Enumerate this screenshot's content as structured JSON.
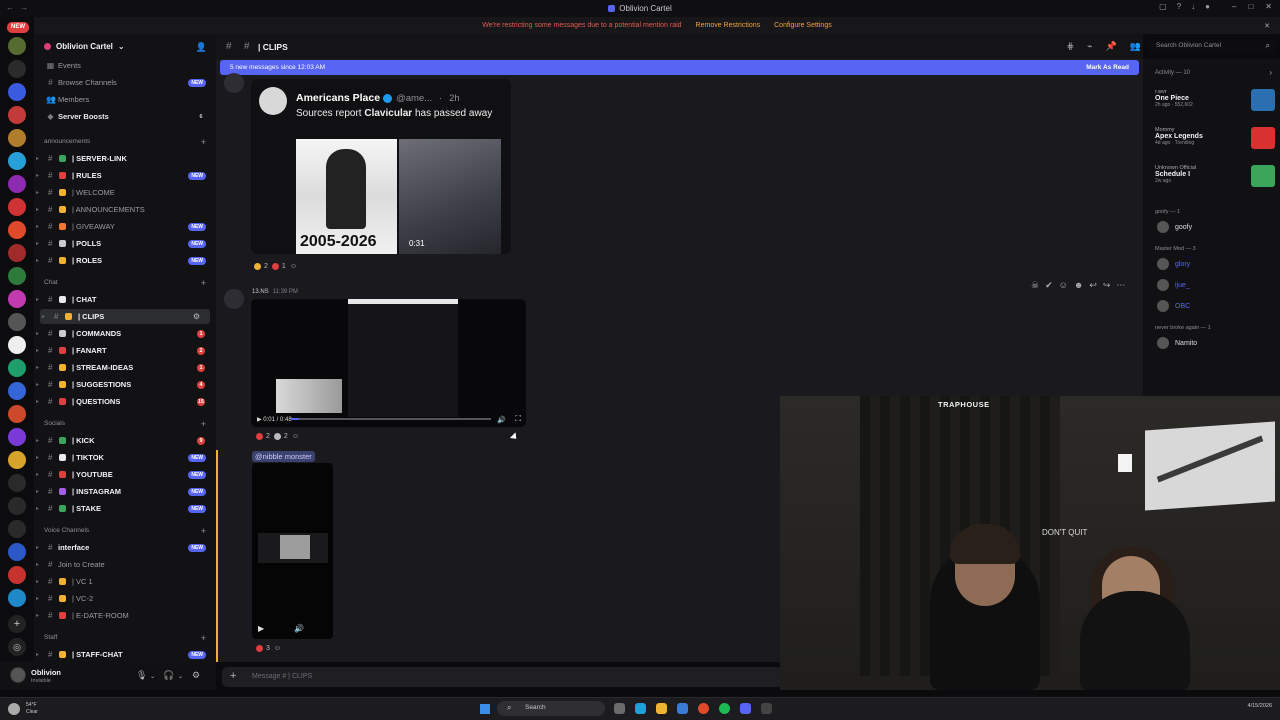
{
  "window": {
    "title": "Oblivion Cartel"
  },
  "banner": {
    "message": "We're restricting some messages due to a potential mention raid",
    "remove_label": "Remove Restrictions",
    "configure_label": "Configure Settings"
  },
  "rail": {
    "new_badge": "NEW"
  },
  "server": {
    "name": "Oblivion Cartel"
  },
  "sidebar": {
    "top_items": [
      {
        "label": "Events"
      },
      {
        "label": "Browse Channels",
        "badge": "NEW"
      },
      {
        "label": "Members"
      },
      {
        "label": "Server Boosts",
        "count": "6"
      }
    ],
    "categories": {
      "announcements": "announcements",
      "chat": "Chat",
      "socials": "Socials",
      "voice": "Voice Channels",
      "staff": "Staff"
    },
    "channels_announcements": [
      {
        "label": "| SERVER-LINK",
        "color": "#3ba55c",
        "bold": true
      },
      {
        "label": "| RULES",
        "color": "#e03f3f",
        "bold": true,
        "badge": "NEW"
      },
      {
        "label": "| WELCOME",
        "color": "#f0b232",
        "bold": false
      },
      {
        "label": "| ANNOUNCEMENTS",
        "color": "#f0b232",
        "bold": false
      },
      {
        "label": "| GIVEAWAY",
        "color": "#f57731",
        "bold": false,
        "badge": "NEW"
      },
      {
        "label": "| POLLS",
        "color": "#c9cbd0",
        "bold": true,
        "badge": "NEW"
      },
      {
        "label": "| ROLES",
        "color": "#f0b232",
        "bold": true,
        "badge": "NEW"
      }
    ],
    "channels_chat": [
      {
        "label": "| CHAT",
        "color": "#e8e9ec",
        "bold": true
      },
      {
        "label": "| CLIPS",
        "color": "#f0b232",
        "bold": true,
        "active": true
      },
      {
        "label": "| COMMANDS",
        "color": "#c9cbd0",
        "bold": true,
        "count": "1"
      },
      {
        "label": "| FANART",
        "color": "#e03f3f",
        "bold": true,
        "count": "2"
      },
      {
        "label": "| STREAM-IDEAS",
        "color": "#f0b232",
        "bold": true,
        "count": "1"
      },
      {
        "label": "| SUGGESTIONS",
        "color": "#f0b232",
        "bold": true,
        "count": "4"
      },
      {
        "label": "| QUESTIONS",
        "color": "#e03f3f",
        "bold": true,
        "count": "15"
      }
    ],
    "channels_socials": [
      {
        "label": "| KICK",
        "color": "#3ba55c",
        "bold": true,
        "count": "9"
      },
      {
        "label": "| TIKTOK",
        "color": "#e8e9ec",
        "bold": true,
        "badge": "NEW"
      },
      {
        "label": "| YOUTUBE",
        "color": "#e03f3f",
        "bold": true,
        "badge": "NEW"
      },
      {
        "label": "| INSTAGRAM",
        "color": "#a45ee5",
        "bold": true,
        "badge": "NEW"
      },
      {
        "label": "| STAKE",
        "color": "#3ba55c",
        "bold": true,
        "badge": "NEW"
      }
    ],
    "channels_voice": [
      {
        "label": "interface",
        "bold": true,
        "badge": "NEW"
      },
      {
        "label": "Join to Create",
        "bold": false
      },
      {
        "label": "| VC 1",
        "color": "#f0b232",
        "bold": false
      },
      {
        "label": "| VC-2",
        "color": "#f0b232",
        "bold": false
      },
      {
        "label": "| E-DATE-ROOM",
        "color": "#e03f3f",
        "bold": false
      }
    ],
    "channels_staff": [
      {
        "label": "| STAFF-CHAT",
        "color": "#f0b232",
        "bold": true,
        "badge": "NEW"
      }
    ]
  },
  "user": {
    "name": "Oblivion",
    "status": "Invisible"
  },
  "channel": {
    "name": "| CLIPS"
  },
  "search": {
    "placeholder": "Search Oblivion Cartel"
  },
  "newbar": {
    "text": "5 new messages since 12:03 AM",
    "mark": "Mark As Read"
  },
  "embed": {
    "author": "Americans Place",
    "handle": "@ame...",
    "age": "2h",
    "text_pre": "Sources report ",
    "text_bold": "Clavicular",
    "text_post": " has passed away",
    "image_caption": "2005-2026",
    "video_duration": "0:31"
  },
  "reactions1": [
    {
      "count": "2",
      "color": "#f0b232"
    },
    {
      "count": "1",
      "color": "#e03f3f"
    }
  ],
  "msg2": {
    "author": "13.NS",
    "time": "11:39 PM"
  },
  "video1": {
    "time": "0:01 / 0:48"
  },
  "reactions2": [
    {
      "count": "2",
      "color": "#e03f3f"
    },
    {
      "count": "2",
      "color": "#bbbbbb"
    }
  ],
  "mention": "@nibble monster",
  "reactions3": [
    {
      "count": "3",
      "color": "#e03f3f"
    }
  ],
  "composer": {
    "placeholder": "Message # | CLIPS"
  },
  "activity": {
    "header": "Activity — 10",
    "items": [
      {
        "line1": "r.wvr",
        "line2": "One Piece",
        "line3": "2h ago · 552,602",
        "color": "#2c6fb0"
      },
      {
        "line1": "Mommy",
        "line2": "Apex Legends",
        "line3": "4d ago · Trending",
        "color": "#d93030"
      },
      {
        "line1": "Unknown Official",
        "line2": "Schedule I",
        "line3": "2w ago",
        "color": "#3ba55c"
      }
    ],
    "groups": [
      {
        "header": "goofy — 1",
        "members": [
          "goofy"
        ]
      },
      {
        "header": "Master Mod — 3",
        "members": [
          "glory",
          "ijue_",
          "OBC"
        ]
      },
      {
        "header": "never broke again — 1",
        "members": [
          "Namito"
        ]
      }
    ]
  },
  "webcam": {
    "sign": "TRAPHOUSE",
    "neon": "DON'T QUIT"
  },
  "taskbar": {
    "weather_temp": "54°F",
    "weather_text": "Clear",
    "search_label": "Search",
    "date": "4/15/2026"
  }
}
